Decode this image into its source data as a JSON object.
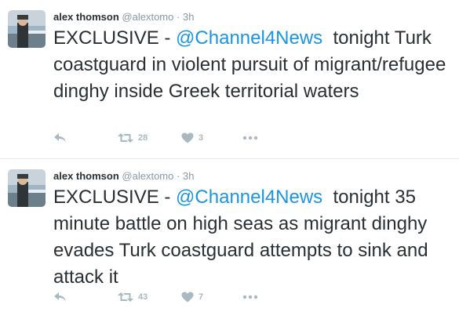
{
  "colors": {
    "link": "#1b95e0",
    "muted": "#8899a6",
    "icon": "#aab8c2",
    "text": "#292f33"
  },
  "tweets": [
    {
      "name": "alex thomson",
      "handle": "@alextomo",
      "separator": "·",
      "time": "3h",
      "text_prefix": "EXCLUSIVE - ",
      "mention": "@Channel4News",
      "text_body": "  tonight Turk coastguard in violent pursuit of migrant/refugee dinghy inside Greek territorial waters",
      "retweets": "28",
      "likes": "3",
      "icons": {
        "reply": "reply-icon",
        "retweet": "retweet-icon",
        "like": "heart-icon",
        "more": "more-icon"
      }
    },
    {
      "name": "alex thomson",
      "handle": "@alextomo",
      "separator": "·",
      "time": "3h",
      "text_prefix": "EXCLUSIVE - ",
      "mention": "@Channel4News",
      "text_body": "  tonight 35 minute battle on high seas as migrant dinghy evades Turk coastguard attempts to sink and attack it",
      "retweets": "43",
      "likes": "7",
      "icons": {
        "reply": "reply-icon",
        "retweet": "retweet-icon",
        "like": "heart-icon",
        "more": "more-icon"
      }
    }
  ]
}
